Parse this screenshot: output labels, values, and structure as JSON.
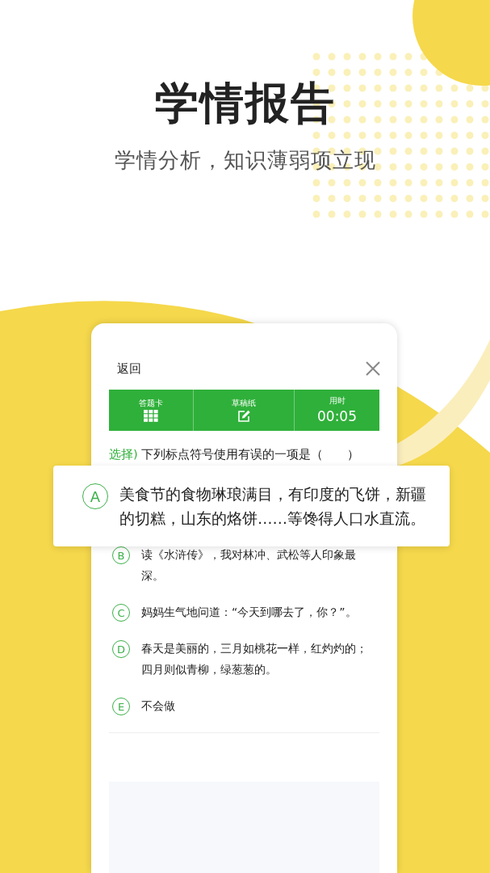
{
  "title": "学情报告",
  "subtitle": "学情分析，知识薄弱项立现",
  "phone": {
    "back": "返回",
    "toolbar": [
      {
        "kind": "grid",
        "label": "答题卡"
      },
      {
        "kind": "pencil",
        "label": "草稿纸"
      },
      {
        "kind": "timer",
        "label": "用时",
        "value": "00:05"
      }
    ],
    "question": {
      "tag": "选择)",
      "text": "下列标点符号使用有误的一项是（　　）"
    },
    "options": [
      {
        "letter": "A",
        "text": "美食节的食物琳琅满目，有印度的飞饼，新疆的切糕，山东的烙饼……等馋得人口水直流。",
        "highlighted": true
      },
      {
        "letter": "B",
        "text": "读《水浒传》，我对林冲、武松等人印象最深。",
        "highlighted": false
      },
      {
        "letter": "C",
        "text": "妈妈生气地问道：“今天到哪去了，你？”。",
        "highlighted": false
      },
      {
        "letter": "D",
        "text": "春天是美丽的，三月如桃花一样，红灼灼的；四月则似青柳，绿葱葱的。",
        "highlighted": false
      },
      {
        "letter": "E",
        "text": "不会做",
        "highlighted": false
      }
    ]
  }
}
